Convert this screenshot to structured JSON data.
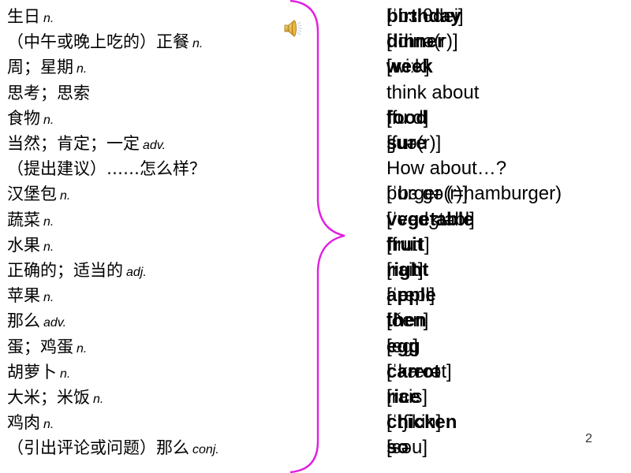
{
  "slide": {
    "page_number": "2",
    "accent_color": "#e020e0",
    "speaker_icon": "speaker-sound-icon"
  },
  "vocab": [
    {
      "zh": "生日",
      "pos": "n.",
      "word": "birthday",
      "phonetic": "[ˈbɜːθdei]",
      "word_bold": true
    },
    {
      "zh": "（中午或晚上吃的）正餐",
      "pos": "n.",
      "word": "dinner",
      "phonetic": "[ˈdinə(r)]",
      "word_bold": true
    },
    {
      "zh": "周；星期",
      "pos": "n.",
      "word": "week",
      "phonetic": "[wiːk]",
      "word_bold": true
    },
    {
      "zh": "思考；思索",
      "pos": "",
      "word": "think about",
      "phonetic": "",
      "word_bold": false
    },
    {
      "zh": "食物",
      "pos": "n.",
      "word": "food",
      "phonetic": "[fuːd]",
      "word_bold": true
    },
    {
      "zh": "当然；肯定；一定",
      "pos": "adv.",
      "word": "sure",
      "phonetic": "[ʃuə(r)]",
      "word_bold": true
    },
    {
      "zh": "（提出建议）……怎么样？",
      "pos": "",
      "word": "How about…?",
      "phonetic": "",
      "word_bold": false
    },
    {
      "zh": "汉堡包",
      "pos": "n.",
      "word": "burger (=hamburger)",
      "phonetic": "[ˈbɜːɡə(r)]",
      "word_bold": false
    },
    {
      "zh": "蔬菜",
      "pos": "n.",
      "word": "vegetable",
      "phonetic": "[ˈvedʒtəbl]",
      "word_bold": true
    },
    {
      "zh": "水果",
      "pos": "n.",
      "word": "fruit",
      "phonetic": "[fruːt]",
      "word_bold": true
    },
    {
      "zh": "正确的；适当的",
      "pos": "adj.",
      "word": "right",
      "phonetic": "[rait]",
      "word_bold": true
    },
    {
      "zh": "苹果",
      "pos": "n.",
      "word": "apple",
      "phonetic": "[ˈæpl]",
      "word_bold": true
    },
    {
      "zh": "那么",
      "pos": "adv.",
      "word": "then",
      "phonetic": "[ðen]",
      "word_bold": true
    },
    {
      "zh": "蛋；鸡蛋",
      "pos": "n.",
      "word": "egg",
      "phonetic": "[eg]",
      "word_bold": true
    },
    {
      "zh": "胡萝卜",
      "pos": "n.",
      "word": "carrot",
      "phonetic": "[ˈkærət]",
      "word_bold": true
    },
    {
      "zh": "大米；米饭",
      "pos": "n.",
      "word": "rice",
      "phonetic": "[rais]",
      "word_bold": true
    },
    {
      "zh": "鸡肉",
      "pos": "n.",
      "word": "chicken",
      "phonetic": "[ˈtʃikin]",
      "word_bold": true
    },
    {
      "zh": "（引出评论或问题）那么",
      "pos": "conj.",
      "word": "so",
      "phonetic": "[səu]",
      "word_bold": true
    }
  ]
}
